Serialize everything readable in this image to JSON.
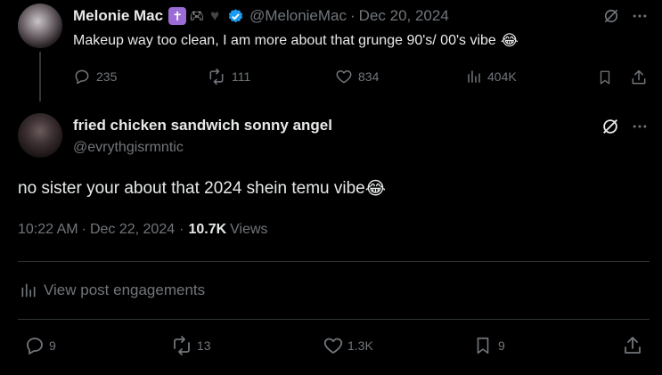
{
  "parent": {
    "name": "Melonie Mac",
    "handle": "@MelonieMac",
    "separator": "·",
    "date": "Dec 20, 2024",
    "text": "Makeup way too clean, I am more about that grunge 90's/ 00's vibe",
    "emoji": "😂",
    "actions": {
      "replies": "235",
      "reposts": "111",
      "likes": "834",
      "views": "404K"
    }
  },
  "reply": {
    "name": "fried chicken sandwich sonny angel",
    "handle": "@evrythgisrmntic",
    "text": "no sister your about that 2024 shein temu vibe",
    "emoji": "😂",
    "time": "10:22 AM",
    "separator": "·",
    "date": "Dec 22, 2024",
    "separator2": "·",
    "views_count": "10.7K",
    "views_label": "Views",
    "engagements_label": "View post engagements",
    "actions": {
      "replies": "9",
      "reposts": "13",
      "likes": "1.3K",
      "bookmarks": "9"
    }
  },
  "colors": {
    "background": "#000000",
    "text": "#e7e9ea",
    "muted": "#71767b",
    "verified": "#1d9bf0",
    "divider": "#2f3336"
  },
  "icons": [
    "cross-badge-icon",
    "gamepad-icon",
    "heart-badge-icon",
    "verified-badge-icon",
    "grok-icon",
    "more-icon",
    "reply-icon",
    "repost-icon",
    "like-icon",
    "views-icon",
    "bookmark-icon",
    "share-icon"
  ]
}
